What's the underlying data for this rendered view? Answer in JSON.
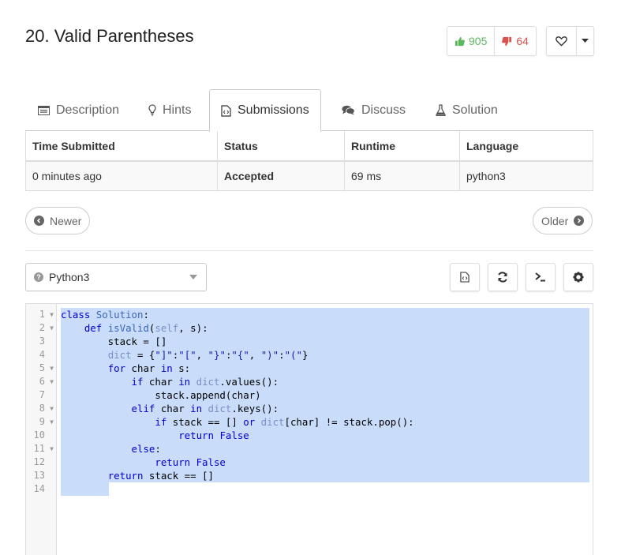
{
  "problem": {
    "title": "20. Valid Parentheses"
  },
  "votes": {
    "likes": "905",
    "dislikes": "64"
  },
  "tabs": [
    {
      "label": "Description",
      "icon": "description-icon"
    },
    {
      "label": "Hints",
      "icon": "lightbulb-icon"
    },
    {
      "label": "Submissions",
      "icon": "code-file-icon",
      "active": true
    },
    {
      "label": "Discuss",
      "icon": "comments-icon"
    },
    {
      "label": "Solution",
      "icon": "flask-icon"
    }
  ],
  "submissions": {
    "headers": [
      "Time Submitted",
      "Status",
      "Runtime",
      "Language"
    ],
    "rows": [
      {
        "time": "0 minutes ago",
        "status": "Accepted",
        "runtime": "69 ms",
        "language": "python3"
      }
    ]
  },
  "nav": {
    "newer": "Newer",
    "older": "Older"
  },
  "editor": {
    "language": "Python3",
    "line_numbers": [
      "1",
      "2",
      "3",
      "4",
      "5",
      "6",
      "7",
      "8",
      "9",
      "10",
      "11",
      "12",
      "13",
      "14"
    ],
    "code": [
      "class Solution:",
      "    def isValid(self, s):",
      "        stack = []",
      "        dict = {\"]\":\"[\", \"}\":\"{\", \")\":\"(\"}",
      "        for char in s:",
      "            if char in dict.values():",
      "                stack.append(char)",
      "            elif char in dict.keys():",
      "                if stack == [] or dict[char] != stack.pop():",
      "                    return False",
      "            else:",
      "                return False",
      "        return stack == []",
      ""
    ]
  },
  "colors": {
    "accepted": "#5cb85c",
    "like": "#5cb85c",
    "dislike": "#d9534f",
    "selection": "#c9dcfa"
  }
}
